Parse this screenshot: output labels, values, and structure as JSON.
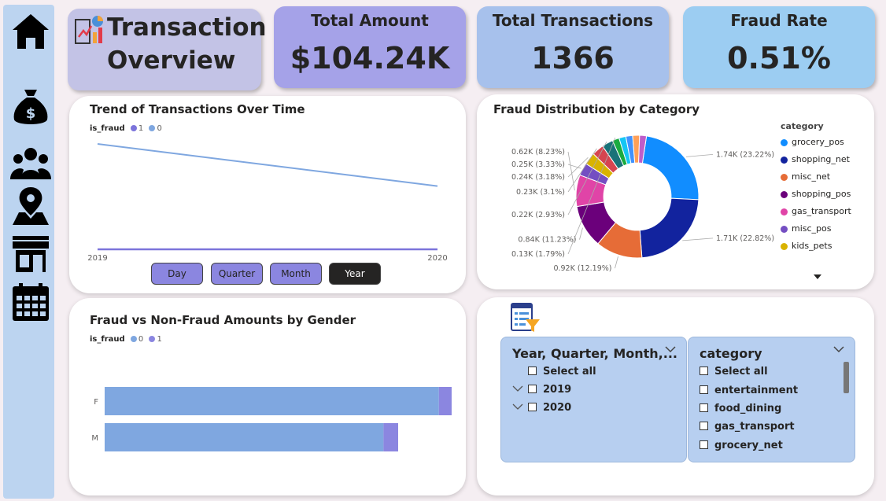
{
  "nav": {
    "items": [
      {
        "name": "home-icon"
      },
      {
        "name": "money-bag-icon"
      },
      {
        "name": "users-icon"
      },
      {
        "name": "map-pin-icon"
      },
      {
        "name": "store-icon"
      },
      {
        "name": "calendar-icon"
      }
    ]
  },
  "header": {
    "title_line1": "Transaction",
    "title_line2": "Overview",
    "logo_icon": "report-chart-icon"
  },
  "kpis": {
    "total_amount": {
      "label": "Total Amount",
      "value": "$104.24K"
    },
    "total_transactions": {
      "label": "Total Transactions",
      "value": "1366"
    },
    "fraud_rate": {
      "label": "Fraud Rate",
      "value": "0.51%"
    }
  },
  "trend": {
    "title": "Trend of Transactions Over Time",
    "legend_title": "is_fraud",
    "legend": [
      {
        "label": "1",
        "color": "#7c74db"
      },
      {
        "label": "0",
        "color": "#7fa7e0"
      }
    ],
    "buttons": [
      {
        "label": "Day",
        "active": false
      },
      {
        "label": "Quarter",
        "active": false
      },
      {
        "label": "Month",
        "active": false
      },
      {
        "label": "Year",
        "active": true
      }
    ]
  },
  "donut": {
    "title": "Fraud Distribution by Category",
    "legend_title": "category",
    "more_icon": "chevron-down-icon"
  },
  "gender": {
    "title": "Fraud vs Non-Fraud Amounts by Gender",
    "legend_title": "is_fraud",
    "legend": [
      {
        "label": "0",
        "color": "#7fa7e0"
      },
      {
        "label": "1",
        "color": "#8b86e0"
      }
    ]
  },
  "slicers": {
    "icon": "filter-report-icon",
    "date": {
      "title": "Year, Quarter, Month,...",
      "options": [
        "Select all",
        "2019",
        "2020"
      ]
    },
    "category": {
      "title": "category",
      "options": [
        "Select all",
        "entertainment",
        "food_dining",
        "gas_transport",
        "grocery_net"
      ]
    }
  },
  "chart_data": [
    {
      "type": "line",
      "title": "Trend of Transactions Over Time",
      "x": [
        "2019",
        "2020"
      ],
      "series": [
        {
          "name": "0",
          "values": [
            1.0,
            0.6
          ],
          "color": "#7fa7e0"
        },
        {
          "name": "1",
          "values": [
            0.0,
            0.0
          ],
          "color": "#7c74db"
        }
      ]
    },
    {
      "type": "pie",
      "title": "Fraud Distribution by Category",
      "hole": 0.55,
      "slices": [
        {
          "category": "grocery_pos",
          "value": 1.74,
          "percent": 23.22,
          "label": "1.74K (23.22%)",
          "color": "#118dff"
        },
        {
          "category": "shopping_net",
          "value": 1.71,
          "percent": 22.82,
          "label": "1.71K (22.82%)",
          "color": "#12239e"
        },
        {
          "category": "misc_net",
          "value": 0.92,
          "percent": 12.19,
          "label": "0.92K (12.19%)",
          "color": "#e66c37"
        },
        {
          "category": "shopping_pos",
          "value": 0.84,
          "percent": 11.23,
          "label": "0.84K (11.23%)",
          "color": "#6b007b"
        },
        {
          "category": "gas_transport",
          "value": 0.62,
          "percent": 8.23,
          "label": "0.62K (8.23%)",
          "color": "#e044a7"
        },
        {
          "category": "misc_pos",
          "value": 0.25,
          "percent": 3.33,
          "label": "0.25K (3.33%)",
          "color": "#744ec2"
        },
        {
          "category": "kids_pets",
          "value": 0.24,
          "percent": 3.18,
          "label": "0.24K (3.18%)",
          "color": "#d9b300"
        },
        {
          "category": "",
          "value": 0.23,
          "percent": 3.1,
          "label": "0.23K (3.1%)",
          "color": "#d64550"
        },
        {
          "category": "",
          "value": 0.22,
          "percent": 2.93,
          "label": "0.22K (2.93%)",
          "color": "#197278"
        },
        {
          "category": "",
          "value": 0.13,
          "percent": 1.79,
          "label": "0.13K (1.79%)",
          "color": "#1aab40"
        },
        {
          "category": "",
          "value": 0.13,
          "percent": 1.79,
          "label": "",
          "color": "#15c6f4"
        },
        {
          "category": "",
          "value": 0.13,
          "percent": 1.79,
          "label": "",
          "color": "#4092ff"
        },
        {
          "category": "",
          "value": 0.13,
          "percent": 1.79,
          "label": "",
          "color": "#ffa058"
        },
        {
          "category": "",
          "value": 0.13,
          "percent": 1.79,
          "label": "",
          "color": "#be5dc9"
        }
      ]
    },
    {
      "type": "bar",
      "orientation": "horizontal",
      "stacked": true,
      "title": "Fraud vs Non-Fraud Amounts by Gender",
      "categories": [
        "F",
        "M"
      ],
      "series": [
        {
          "name": "0",
          "values": [
            52.5,
            43.8
          ],
          "color": "#7fa7e0"
        },
        {
          "name": "1",
          "values": [
            2.0,
            2.3
          ],
          "color": "#8b86e0"
        }
      ],
      "xlim": [
        0,
        55
      ]
    }
  ]
}
